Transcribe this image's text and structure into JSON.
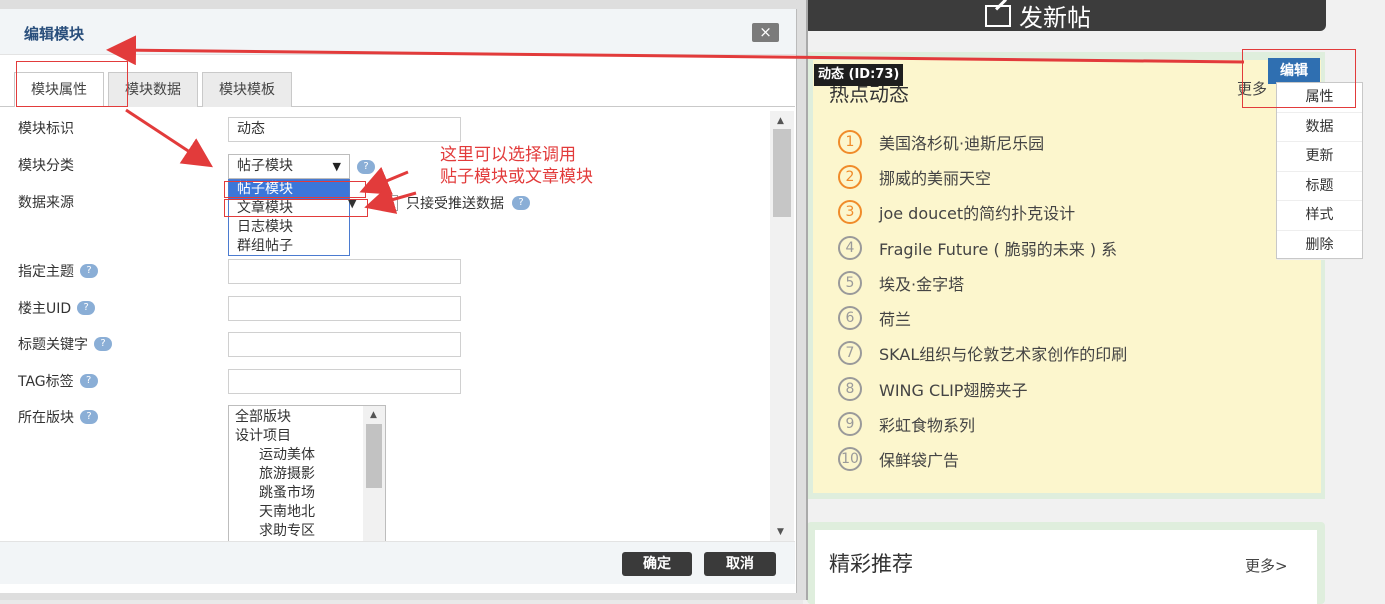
{
  "background": {
    "post_button_label": "发新帖",
    "hot_panel": {
      "title": "热点动态",
      "more": "更多",
      "block_tag": "动态 (ID:73)",
      "items": [
        {
          "num": "1",
          "text": "美国洛杉矶·迪斯尼乐园"
        },
        {
          "num": "2",
          "text": "挪威的美丽天空"
        },
        {
          "num": "3",
          "text": "joe doucet的简约扑克设计"
        },
        {
          "num": "4",
          "text": "Fragile Future ( 脆弱的未来 ) 系"
        },
        {
          "num": "5",
          "text": "埃及·金字塔"
        },
        {
          "num": "6",
          "text": "荷兰"
        },
        {
          "num": "7",
          "text": "SKAL组织与伦敦艺术家创作的印刷"
        },
        {
          "num": "8",
          "text": "WING CLIP翅膀夹子"
        },
        {
          "num": "9",
          "text": "彩虹食物系列"
        },
        {
          "num": "10",
          "text": "保鲜袋广告"
        }
      ]
    },
    "edit_tag": "编辑",
    "context_menu": [
      "属性",
      "数据",
      "更新",
      "标题",
      "样式",
      "删除"
    ],
    "recommend_panel": {
      "title": "精彩推荐",
      "more": "更多>"
    }
  },
  "dialog": {
    "title": "编辑模块",
    "close": "×",
    "tabs": [
      "模块属性",
      "模块数据",
      "模块模板"
    ],
    "fields": {
      "identifier_label": "模块标识",
      "identifier_value": "动态",
      "category_label": "模块分类",
      "category_value": "帖子模块",
      "category_options": [
        "帖子模块",
        "文章模块",
        "日志模块",
        "群组帖子"
      ],
      "datasource_label": "数据来源",
      "push_only_label": "只接受推送数据",
      "topic_label": "指定主题",
      "owner_uid_label": "楼主UID",
      "keyword_label": "标题关键字",
      "tag_label": "TAG标签",
      "board_label": "所在版块",
      "boards": [
        {
          "name": "全部版块",
          "sub": false
        },
        {
          "name": "设计项目",
          "sub": false
        },
        {
          "name": "运动美体",
          "sub": true
        },
        {
          "name": "旅游摄影",
          "sub": true
        },
        {
          "name": "跳蚤市场",
          "sub": true
        },
        {
          "name": "天南地北",
          "sub": true
        },
        {
          "name": "求助专区",
          "sub": true
        }
      ]
    },
    "confirm": "确定",
    "cancel": "取消"
  },
  "annotation": {
    "line1": "这里可以选择调用",
    "line2": "贴子模块或文章模块"
  },
  "colors": {
    "annotation_red": "#e23b3b",
    "selected_blue": "#3b76d9",
    "hot_orange": "#f08b2a"
  }
}
